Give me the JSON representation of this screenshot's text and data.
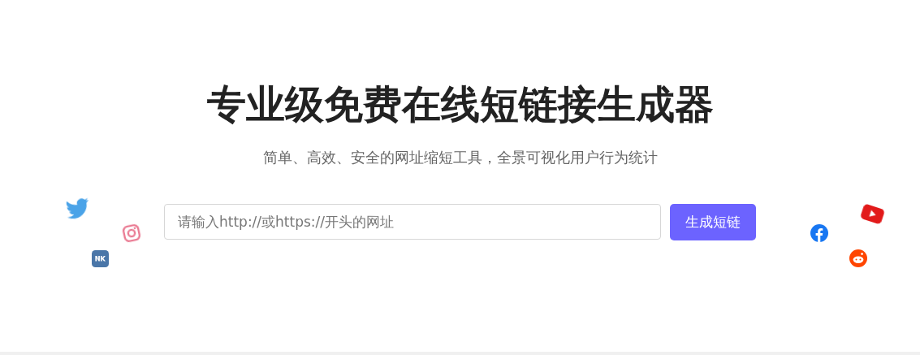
{
  "hero": {
    "title": "专业级免费在线短链接生成器",
    "subtitle": "简单、高效、安全的网址缩短工具，全景可视化用户行为统计"
  },
  "form": {
    "url_input": {
      "placeholder": "请输入http://或https://开头的网址"
    },
    "submit_button": "生成短链"
  }
}
